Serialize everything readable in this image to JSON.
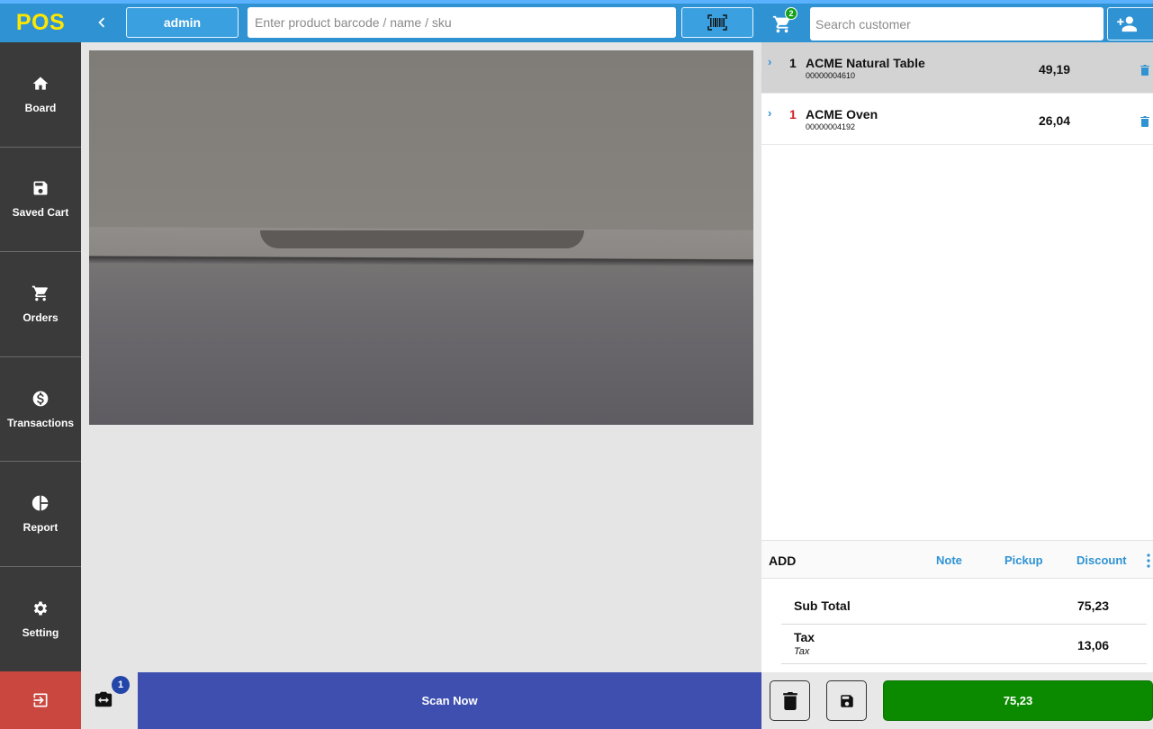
{
  "app": {
    "logo": "POS"
  },
  "sidebar": {
    "items": [
      {
        "label": "Board",
        "icon": "home-icon"
      },
      {
        "label": "Saved Cart",
        "icon": "save-icon"
      },
      {
        "label": "Orders",
        "icon": "cart-icon"
      },
      {
        "label": "Transactions",
        "icon": "dollar-icon"
      },
      {
        "label": "Report",
        "icon": "pie-chart-icon"
      },
      {
        "label": "Setting",
        "icon": "gear-icon"
      }
    ],
    "logout_icon": "logout-icon"
  },
  "topbar": {
    "user": "admin",
    "search_placeholder": "Enter product barcode / name / sku",
    "barcode_icon": "barcode-icon"
  },
  "scanner": {
    "camera_badge": "1",
    "scan_label": "Scan Now"
  },
  "cart": {
    "count_badge": "2",
    "customer_placeholder": "Search customer",
    "items": [
      {
        "qty": "1",
        "name": "ACME Natural Table",
        "sku": "00000004610",
        "price": "49,19"
      },
      {
        "qty": "1",
        "name": "ACME Oven",
        "sku": "00000004192",
        "price": "26,04"
      }
    ],
    "actions": {
      "add": "ADD",
      "note": "Note",
      "pickup": "Pickup",
      "discount": "Discount"
    },
    "subtotal_label": "Sub Total",
    "subtotal_value": "75,23",
    "tax_label": "Tax",
    "tax_sub": "Tax",
    "tax_value": "13,06",
    "pay_label": "75,23"
  },
  "colors": {
    "header": "#2f93d3",
    "sidebar": "#3a3a3a",
    "logout": "#c9473f",
    "scan": "#3e4fb0",
    "pay": "#0b8a00",
    "logo_text": "#ffe600"
  }
}
